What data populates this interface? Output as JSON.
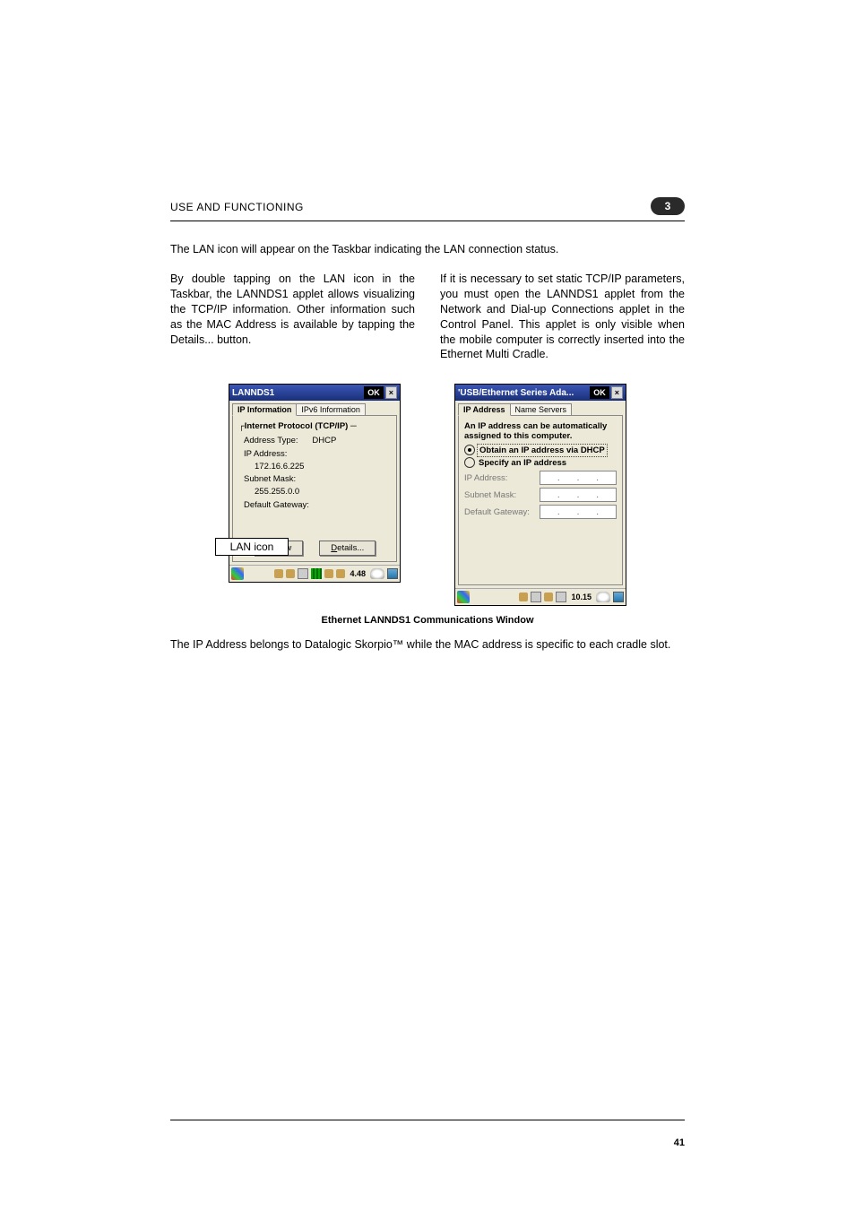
{
  "header": {
    "title": "USE AND FUNCTIONING",
    "chapter": "3"
  },
  "intro": "The LAN icon will appear on the Taskbar indicating the LAN connection status.",
  "columns": {
    "left": "By double tapping on the LAN icon in the Taskbar, the LANNDS1 applet allows visualizing the TCP/IP information. Other information such as the MAC Address is available by tapping the Details... button.",
    "right": "If it is necessary to set static TCP/IP parameters, you must open the LANNDS1 applet from the Network and Dial-up Connections applet in the Control Panel. This applet is only visible when the mobile computer is correctly inserted into the Ethernet Multi Cradle."
  },
  "lan_callout": "LAN icon",
  "win1": {
    "title": "LANNDS1",
    "ok": "OK",
    "close": "×",
    "tab1": "IP Information",
    "tab2": "IPv6 Information",
    "fieldset": "Internet Protocol (TCP/IP)",
    "addr_type_lbl": "Address Type:",
    "addr_type_val": "DHCP",
    "ip_lbl": "IP Address:",
    "ip_val": "172.16.6.225",
    "mask_lbl": "Subnet Mask:",
    "mask_val": "255.255.0.0",
    "gw_lbl": "Default Gateway:",
    "btn_renew": "Renew",
    "btn_details": "Details...",
    "taskbar_time": "4.48"
  },
  "win2": {
    "title": "'USB/Ethernet Series Ada...",
    "ok": "OK",
    "close": "×",
    "tab1": "IP Address",
    "tab2": "Name Servers",
    "hint": "An IP address can be automatically assigned to this computer.",
    "opt_dhcp": "Obtain an IP address via DHCP",
    "opt_static": "Specify an IP address",
    "ip_lbl": "IP Address:",
    "mask_lbl": "Subnet Mask:",
    "gw_lbl": "Default Gateway:",
    "taskbar_time": "10.15"
  },
  "caption": "Ethernet LANNDS1 Communications Window",
  "closing": "The IP Address belongs to Datalogic Skorpio™ while the MAC address is specific to each cradle slot.",
  "page_number": "41"
}
